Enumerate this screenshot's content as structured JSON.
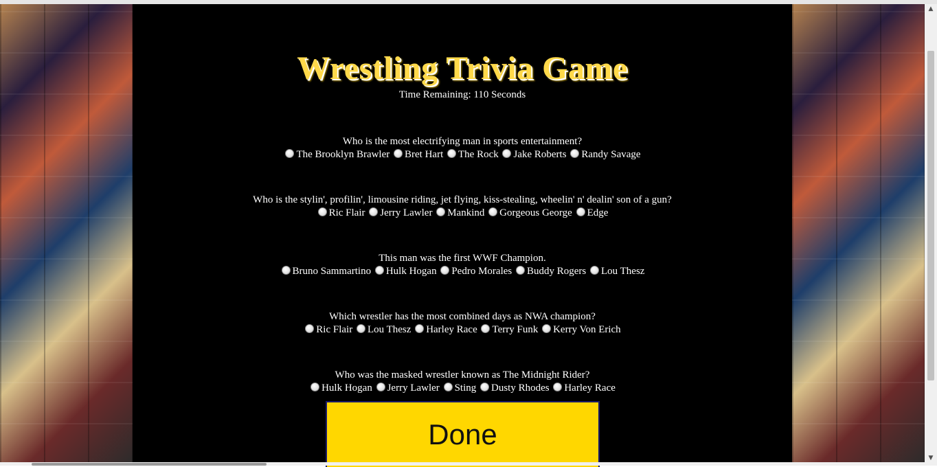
{
  "page": {
    "title": "Wrestling Trivia Game",
    "timer_text": "Time Remaining: 110 Seconds"
  },
  "questions": [
    {
      "text": "Who is the most electrifying man in sports entertainment?",
      "options": [
        "The Brooklyn Brawler",
        "Bret Hart",
        "The Rock",
        "Jake Roberts",
        "Randy Savage"
      ]
    },
    {
      "text": "Who is the stylin', profilin', limousine riding, jet flying, kiss-stealing, wheelin' n' dealin' son of a gun?",
      "options": [
        "Ric Flair",
        "Jerry Lawler",
        "Mankind",
        "Gorgeous George",
        "Edge"
      ]
    },
    {
      "text": "This man was the first WWF Champion.",
      "options": [
        "Bruno Sammartino",
        "Hulk Hogan",
        "Pedro Morales",
        "Buddy Rogers",
        "Lou Thesz"
      ]
    },
    {
      "text": "Which wrestler has the most combined days as NWA champion?",
      "options": [
        "Ric Flair",
        "Lou Thesz",
        "Harley Race",
        "Terry Funk",
        "Kerry Von Erich"
      ]
    },
    {
      "text": "Who was the masked wrestler known as The Midnight Rider?",
      "options": [
        "Hulk Hogan",
        "Jerry Lawler",
        "Sting",
        "Dusty Rhodes",
        "Harley Race"
      ]
    }
  ],
  "done_button": {
    "label": "Done"
  },
  "colors": {
    "background": "#000000",
    "title": "#ffd94a",
    "done_button": "#ffd700"
  }
}
